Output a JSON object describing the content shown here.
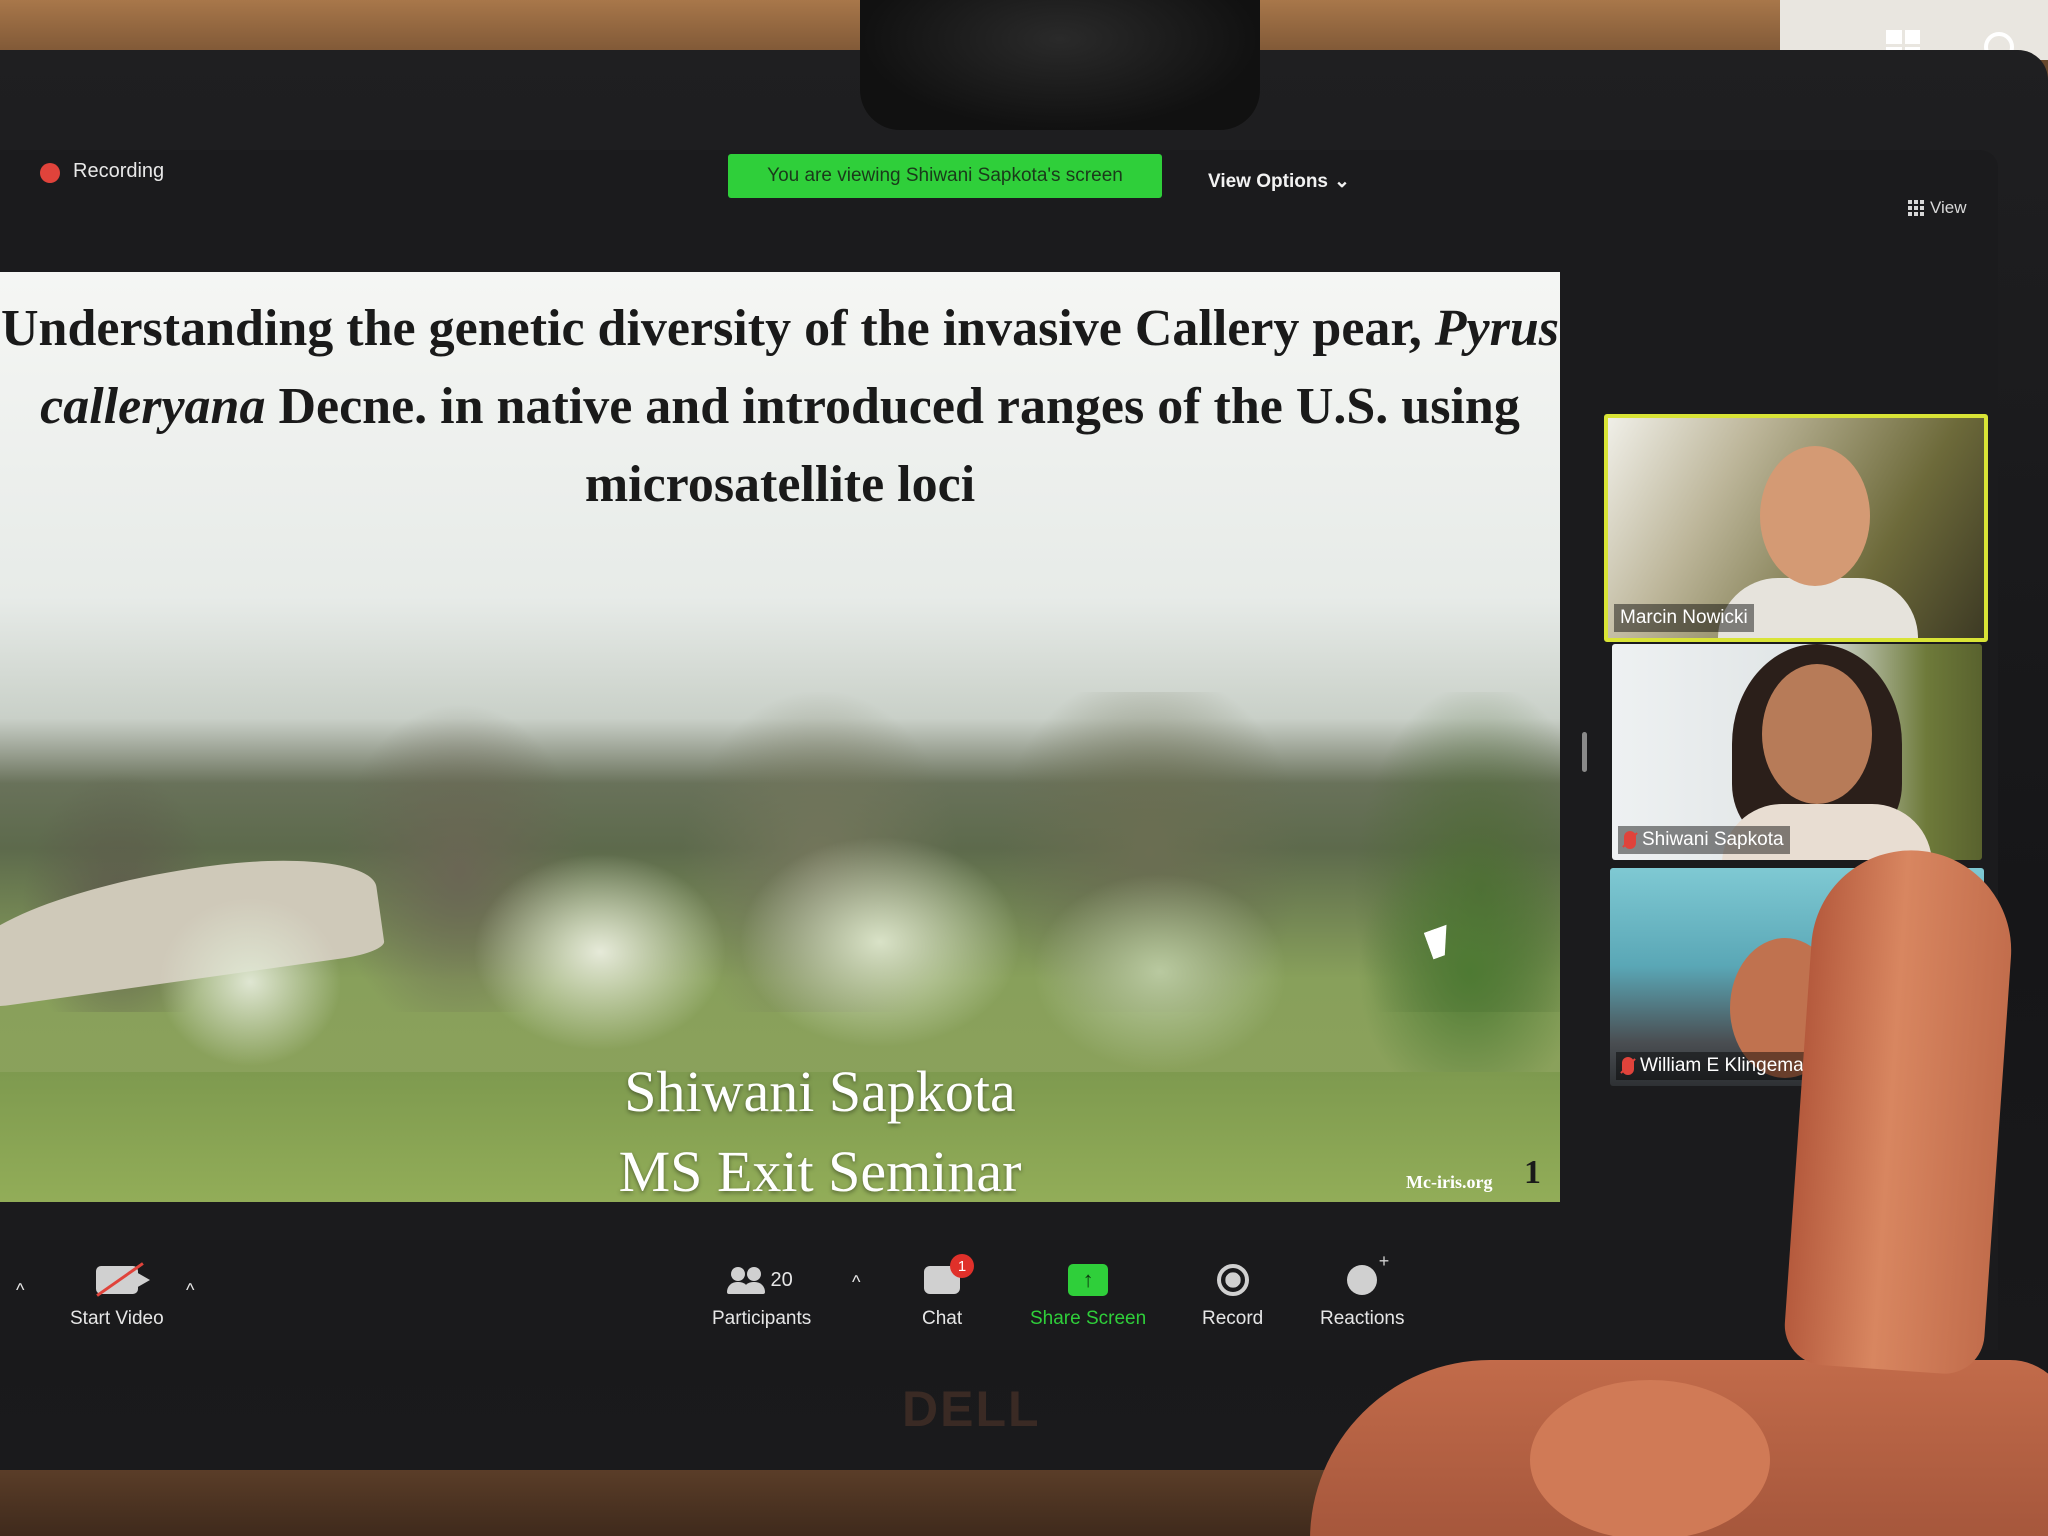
{
  "top_bar": {
    "recording_label": "Recording",
    "viewing_banner": "You are viewing Shiwani Sapkota's screen",
    "view_options_label": "View Options",
    "view_label": "View"
  },
  "slide": {
    "title_part1": "Understanding the genetic diversity of the invasive Callery pear, ",
    "title_italic": "Pyrus calleryana",
    "title_part2": " Decne. in native and introduced ranges of the U.S. using microsatellite loci",
    "presenter_name": "Shiwani Sapkota",
    "event": "MS Exit Seminar",
    "credit": "Mc-iris.org",
    "page_number": "1"
  },
  "participants": [
    {
      "name": "Marcin Nowicki",
      "muted": false,
      "active_speaker": true
    },
    {
      "name": "Shiwani Sapkota",
      "muted": true,
      "active_speaker": false
    },
    {
      "name": "William E Klingeman",
      "muted": true,
      "active_speaker": false
    }
  ],
  "toolbar": {
    "start_video_label": "Start Video",
    "participants_count": "20",
    "participants_label": "Participants",
    "chat_label": "Chat",
    "chat_badge": "1",
    "share_screen_label": "Share Screen",
    "record_label": "Record",
    "reactions_label": "Reactions"
  },
  "hardware": {
    "brand_logo": "DELL"
  },
  "colors": {
    "banner_green": "#2fcf3a",
    "active_speaker_border": "#d9e436",
    "record_red": "#e0433b"
  }
}
